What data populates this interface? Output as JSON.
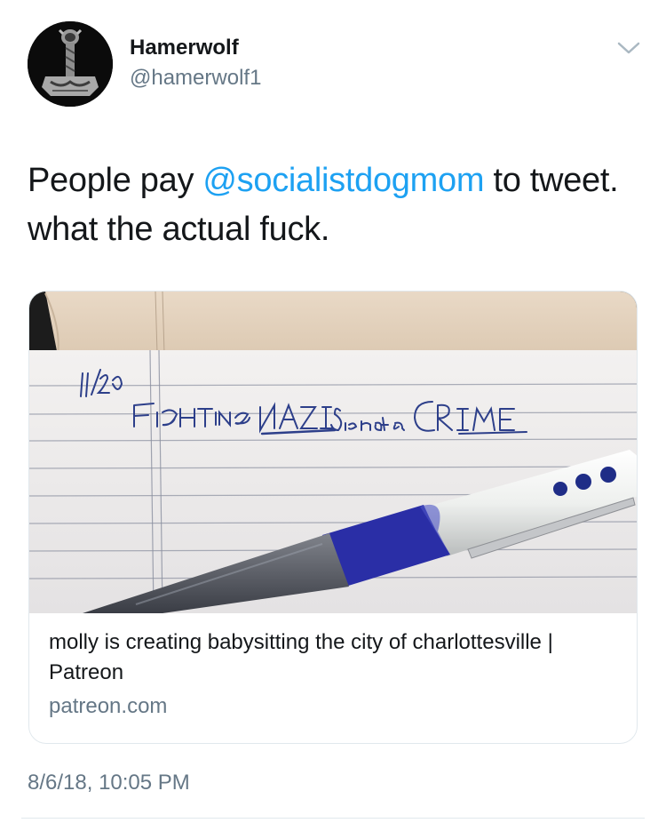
{
  "user": {
    "display_name": "Hamerwolf",
    "handle": "@hamerwolf1",
    "avatar_icon": "thors-hammer-icon"
  },
  "menu_icon": "chevron-down-icon",
  "tweet": {
    "text_before": "People pay ",
    "mention": "@socialistdogmom",
    "text_after": " to tweet.\nwhat the actual fuck."
  },
  "card": {
    "image_handwriting_date": "11/20",
    "image_handwriting": "FIGHTING NAZIS is not a CRIME",
    "title": "molly is creating babysitting the city of charlottesville | Patreon",
    "domain": "patreon.com"
  },
  "timestamp": "8/6/18, 10:05 PM",
  "colors": {
    "text": "#14171a",
    "secondary": "#657786",
    "link": "#1da1f2",
    "border": "#e1e8ed"
  }
}
